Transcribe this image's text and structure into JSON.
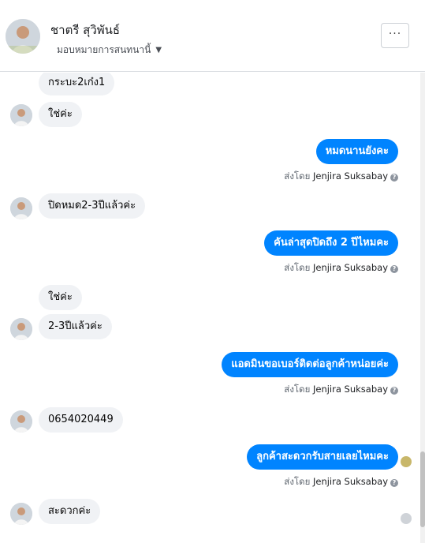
{
  "header": {
    "name": "ชาตรี สุวิพันธ์",
    "subtitle": "มอบหมายการสนทนานี้",
    "more_label": "···"
  },
  "messages": [
    {
      "side": "in",
      "text": "กระบะ2เก๋ง1"
    },
    {
      "side": "in",
      "text": "ใช่ค่ะ"
    },
    {
      "side": "out",
      "text": "หมดนานยังคะ",
      "sent_by_prefix": "ส่งโดย",
      "sent_by": "Jenjira Suksabay"
    },
    {
      "side": "in",
      "text": "ปิดหมด2-3ปีแล้วค่ะ"
    },
    {
      "side": "out",
      "text": "คันล่าสุดปิดถึง 2 ปีไหมคะ",
      "sent_by_prefix": "ส่งโดย",
      "sent_by": "Jenjira Suksabay"
    },
    {
      "side": "in",
      "text": "ใช่ค่ะ"
    },
    {
      "side": "in",
      "text": "2-3ปีแล้วค่ะ"
    },
    {
      "side": "out",
      "text": "แอดมินขอเบอร์ติดต่อลูกค้าหน่อยค่ะ",
      "sent_by_prefix": "ส่งโดย",
      "sent_by": "Jenjira Suksabay"
    },
    {
      "side": "in",
      "text": "0654020449"
    },
    {
      "side": "out",
      "text": "ลูกค้าสะดวกรับสายเลยไหมคะ",
      "sent_by_prefix": "ส่งโดย",
      "sent_by": "Jenjira Suksabay"
    },
    {
      "side": "in",
      "text": "สะดวกค่ะ"
    }
  ],
  "icons": {
    "more": "more-options-icon",
    "caret": "caret-down-icon",
    "help": "question-circle-icon"
  },
  "colors": {
    "outgoing_bubble": "#0084ff",
    "incoming_bubble": "#f0f2f5"
  }
}
